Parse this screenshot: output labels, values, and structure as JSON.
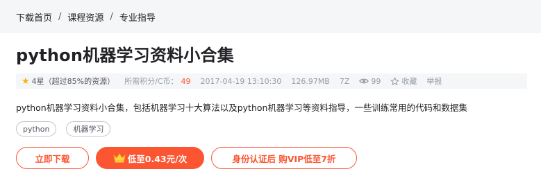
{
  "breadcrumb": {
    "items": [
      "下载首页",
      "课程资源",
      "专业指导"
    ],
    "separator": "/"
  },
  "resource": {
    "title": "python机器学习资料小合集",
    "rating_text": "4星（超过85%的资源）",
    "points_label": "所需积分/C币：",
    "points_value": "49",
    "datetime": "2017-04-19 13:10:30",
    "file_size": "126.97MB",
    "file_type": "7Z",
    "views": "99",
    "favorite_label": "收藏",
    "report_label": "举报",
    "description": "python机器学习资料小合集，包括机器学习十大算法以及python机器学习等资料指导，一些训练常用的代码和数据集",
    "tags": [
      "python",
      "机器学习"
    ]
  },
  "actions": {
    "download_label": "立即下载",
    "vip_price_label": "低至0.43元/次",
    "auth_vip_label": "身份认证后 购VIP低至7折"
  },
  "colors": {
    "accent": "#fc5531",
    "star": "#f7b500",
    "bar_bg": "#f5f6f7",
    "text": "#222226",
    "muted": "#999aaa"
  },
  "icons": [
    "star-icon",
    "eye-icon",
    "favorite-icon",
    "crown-icon"
  ]
}
